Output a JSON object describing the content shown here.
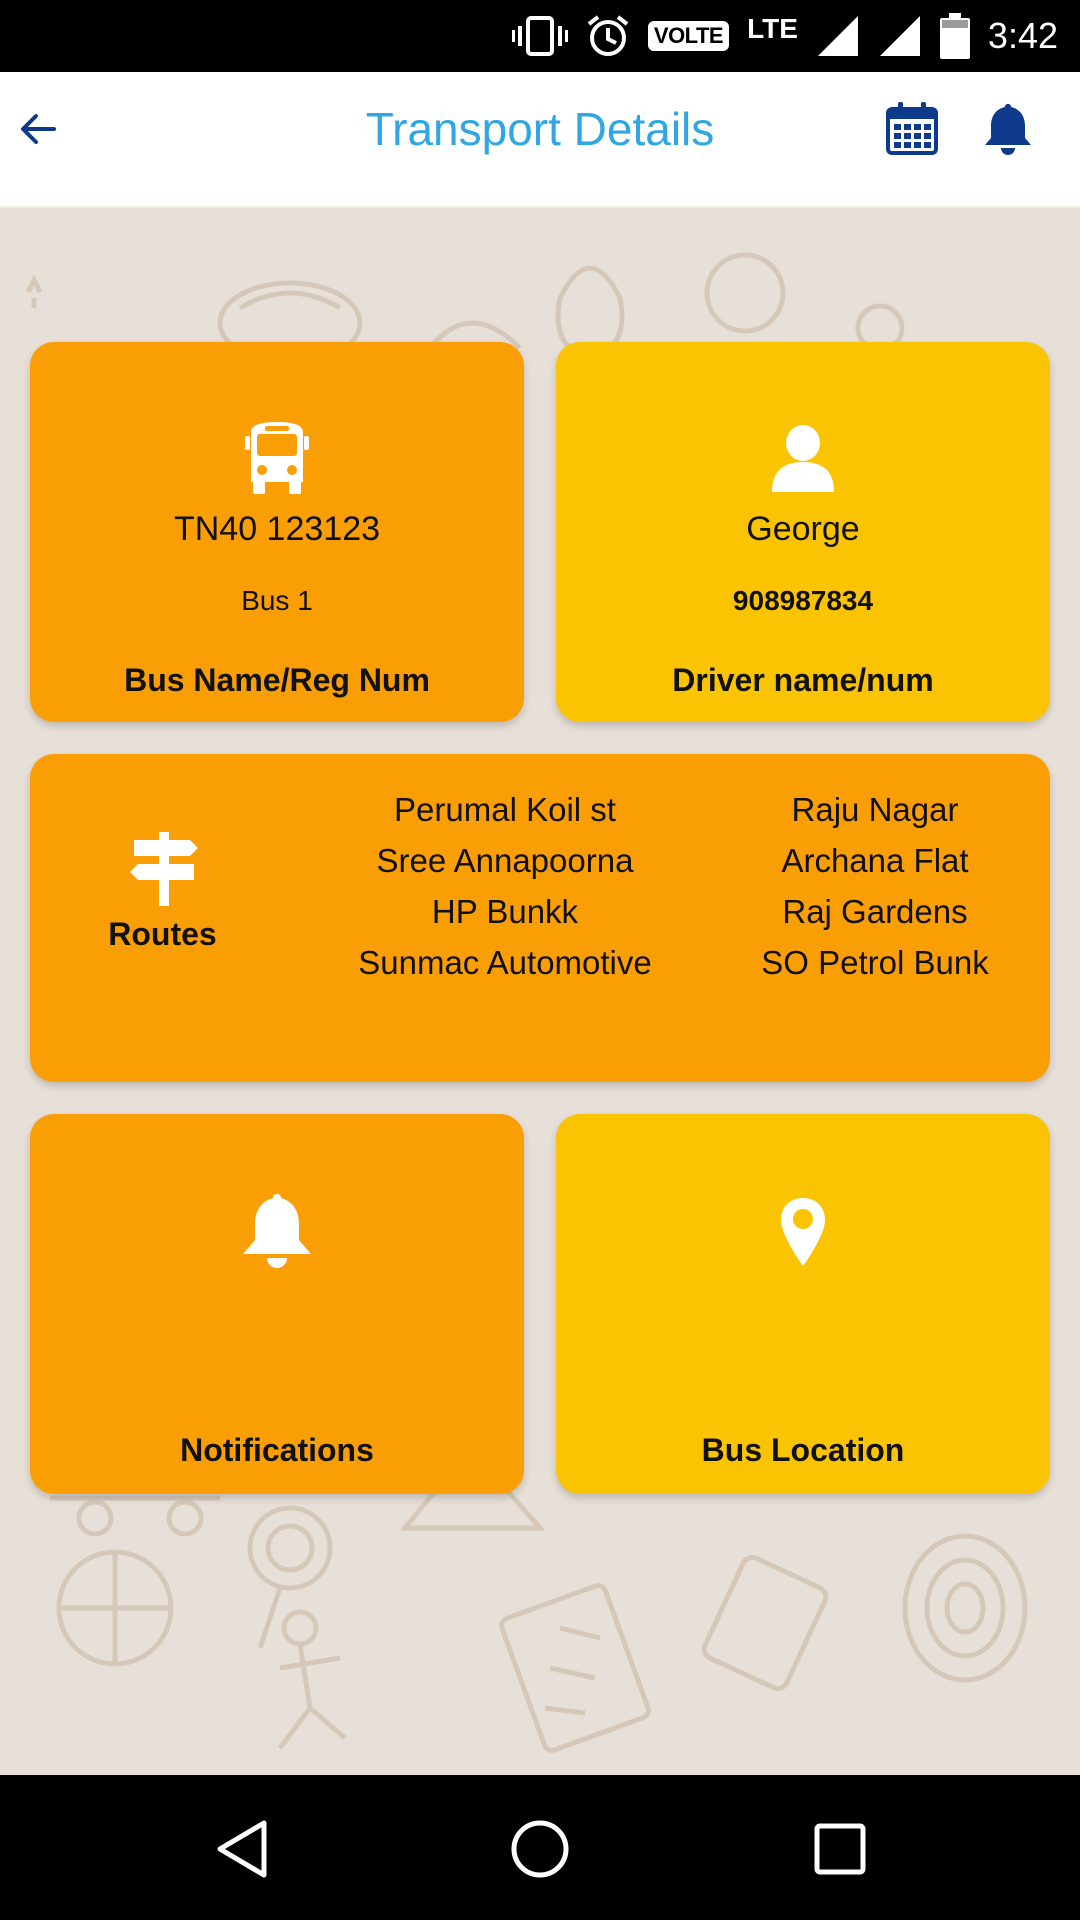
{
  "status_bar": {
    "volte": "VOLTE",
    "network": "LTE",
    "time": "3:42",
    "icons": [
      "vibrate-icon",
      "alarm-icon",
      "signal-icon",
      "signal-icon",
      "battery-icon"
    ]
  },
  "app_bar": {
    "title": "Transport Details",
    "back_icon": "arrow-left-icon",
    "calendar_icon": "calendar-icon",
    "notification_icon": "bell-icon",
    "title_color": "#30a6e3",
    "icon_color": "#0d3a8a"
  },
  "cards": {
    "bus": {
      "icon": "bus-icon",
      "reg_number": "TN40 123123",
      "name": "Bus 1",
      "caption": "Bus Name/Reg Num",
      "color": "#fa9e05"
    },
    "driver": {
      "icon": "person-icon",
      "name": "George",
      "number": "908987834",
      "caption": "Driver name/num",
      "color": "#fac402"
    },
    "routes": {
      "icon": "signpost-icon",
      "label": "Routes",
      "left_stops": [
        "Perumal Koil st",
        "Sree Annapoorna",
        "HP Bunkk",
        "Sunmac Automotive"
      ],
      "right_stops": [
        "Raju Nagar",
        "Archana Flat",
        "Raj Gardens",
        "SO Petrol Bunk"
      ],
      "color": "#fa9e05"
    },
    "notifications": {
      "icon": "bell-icon",
      "caption": "Notifications",
      "color": "#fa9e05"
    },
    "location": {
      "icon": "map-pin-icon",
      "caption": "Bus Location",
      "color": "#fac402"
    }
  },
  "nav_bar": {
    "icons": [
      "back-triangle-icon",
      "home-circle-icon",
      "recents-square-icon"
    ]
  }
}
